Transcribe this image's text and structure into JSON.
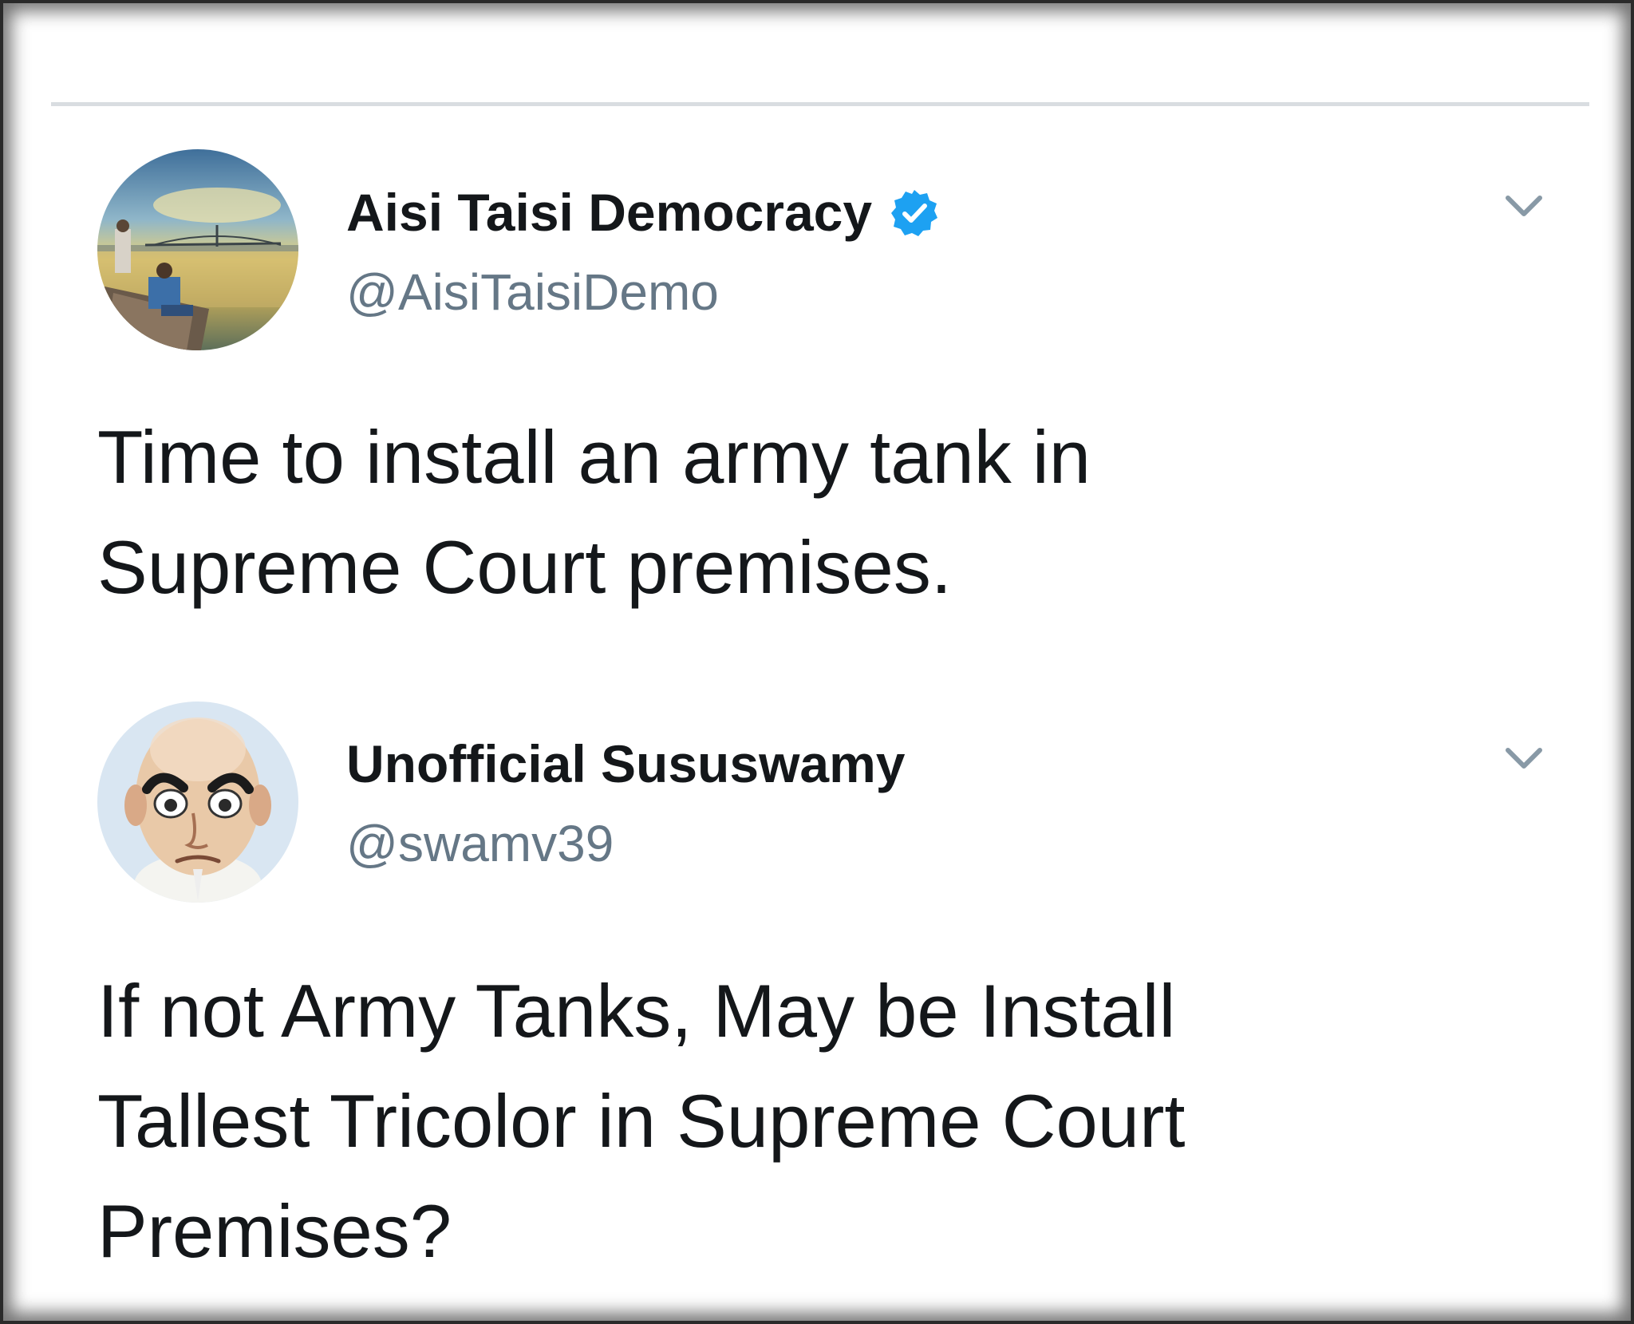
{
  "tweets": [
    {
      "display_name": "Aisi Taisi Democracy",
      "verified": true,
      "handle": "@AisiTaisiDemo",
      "text_lines": [
        "Time to install an army tank in",
        "Supreme Court premises."
      ],
      "avatar_icon": "photo-avatar-icon"
    },
    {
      "display_name": "Unofficial Sususwamy",
      "verified": false,
      "handle": "@swamv39",
      "text_lines": [
        "If not Army Tanks, May be Install",
        "Tallest Tricolor in Supreme Court",
        "Premises?"
      ],
      "avatar_icon": "caricature-avatar-icon"
    }
  ],
  "icons": {
    "verified": "verified-badge-icon",
    "menu": "chevron-down-icon"
  },
  "colors": {
    "text": "#14171a",
    "handle": "#657786",
    "verified_blue": "#1da1f2",
    "divider": "#d9dde1",
    "chevron": "#8899a6"
  }
}
